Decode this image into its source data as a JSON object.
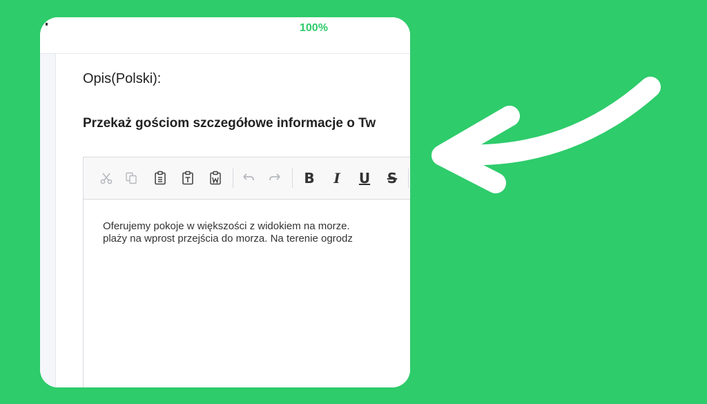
{
  "progress": {
    "label": "100%",
    "value_percent": 100
  },
  "description": {
    "label": "Opis(Polski):",
    "heading": "Przekaż gościom szczegółowe informacje o Tw"
  },
  "editor": {
    "toolbar": [
      {
        "name": "cut-icon",
        "enabled": false
      },
      {
        "name": "copy-icon",
        "enabled": false
      },
      {
        "name": "paste-icon",
        "enabled": true
      },
      {
        "name": "paste-text-icon",
        "enabled": true
      },
      {
        "name": "paste-word-icon",
        "enabled": true
      },
      {
        "name": "undo-icon",
        "enabled": false
      },
      {
        "name": "redo-icon",
        "enabled": false
      },
      {
        "name": "bold",
        "label": "B"
      },
      {
        "name": "italic",
        "label": "I"
      },
      {
        "name": "underline",
        "label": "U"
      },
      {
        "name": "strikethrough",
        "label": "S"
      }
    ],
    "content_line1": "Oferujemy pokoje w większości z widokiem na morze.",
    "content_line2": "plaży na wprost przejścia do morza. Na terenie ogrodz"
  },
  "colors": {
    "background": "#2ecc6b",
    "accent": "#2ecc6b",
    "arrow": "#ffffff"
  }
}
